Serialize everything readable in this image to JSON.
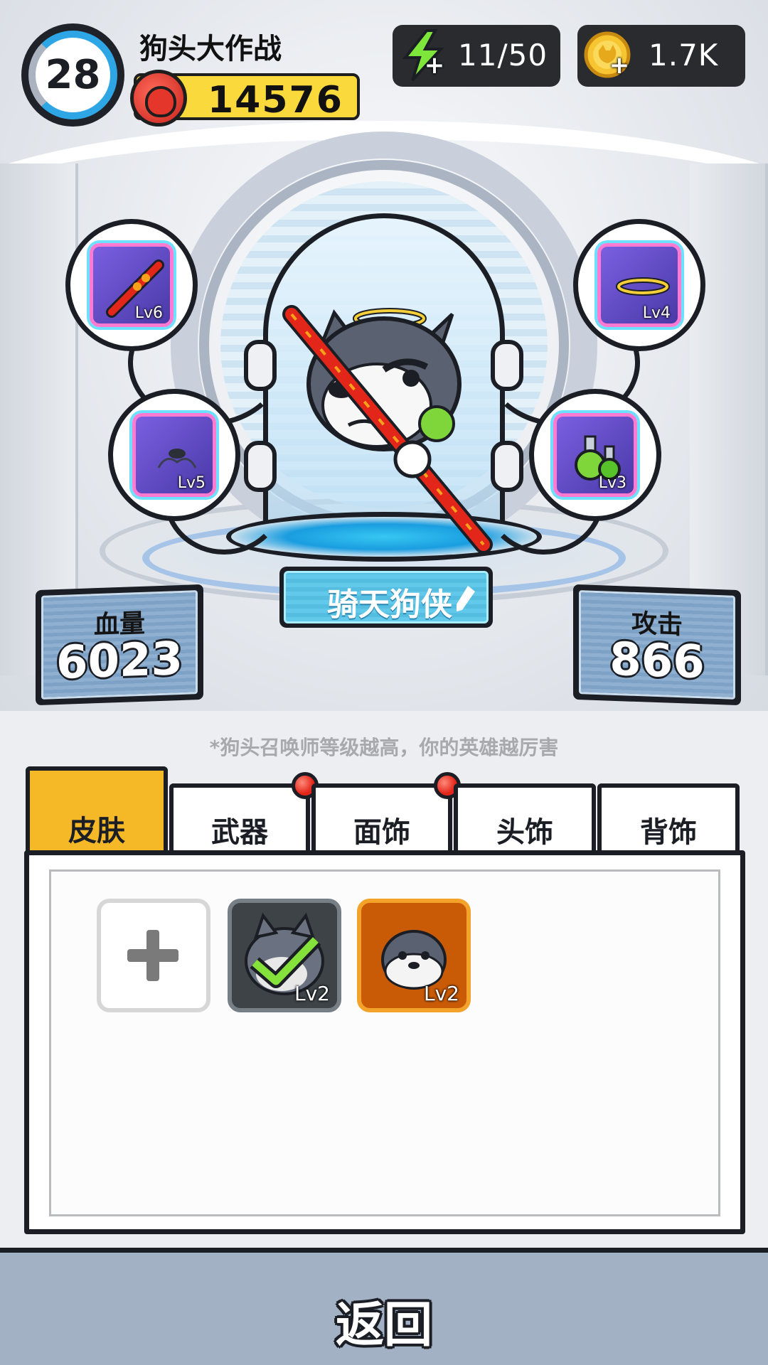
{
  "header": {
    "level": "28",
    "game_title": "狗头大作战",
    "score": "14576",
    "energy": "11/50",
    "coins": "1.7K"
  },
  "equipment_slots": [
    {
      "name": "staff",
      "level": "Lv6"
    },
    {
      "name": "halo",
      "level": "Lv4"
    },
    {
      "name": "mustache",
      "level": "Lv5"
    },
    {
      "name": "potion",
      "level": "Lv3"
    }
  ],
  "hero": {
    "name": "骑天狗侠"
  },
  "stats": {
    "hp_label": "血量",
    "hp_value": "6023",
    "atk_label": "攻击",
    "atk_value": "866"
  },
  "hint": "*狗头召唤师等级越高，你的英雄越厉害",
  "tabs": [
    {
      "label": "皮肤",
      "active": true,
      "badge": false
    },
    {
      "label": "武器",
      "active": false,
      "badge": true
    },
    {
      "label": "面饰",
      "active": false,
      "badge": true
    },
    {
      "label": "头饰",
      "active": false,
      "badge": false
    },
    {
      "label": "背饰",
      "active": false,
      "badge": false
    }
  ],
  "inventory": [
    {
      "type": "add",
      "icon": "plus-icon"
    },
    {
      "type": "skin",
      "level": "Lv2",
      "equipped": true,
      "icon": "husky-checked-icon"
    },
    {
      "type": "skin",
      "level": "Lv2",
      "equipped": false,
      "icon": "seal-dog-icon"
    }
  ],
  "footer": {
    "back_label": "返回"
  },
  "colors": {
    "accent_yellow": "#f5b928",
    "plate_blue": "#62c9ea",
    "badge_red": "#e3261a",
    "bottom_bar": "#a3b1c4"
  }
}
